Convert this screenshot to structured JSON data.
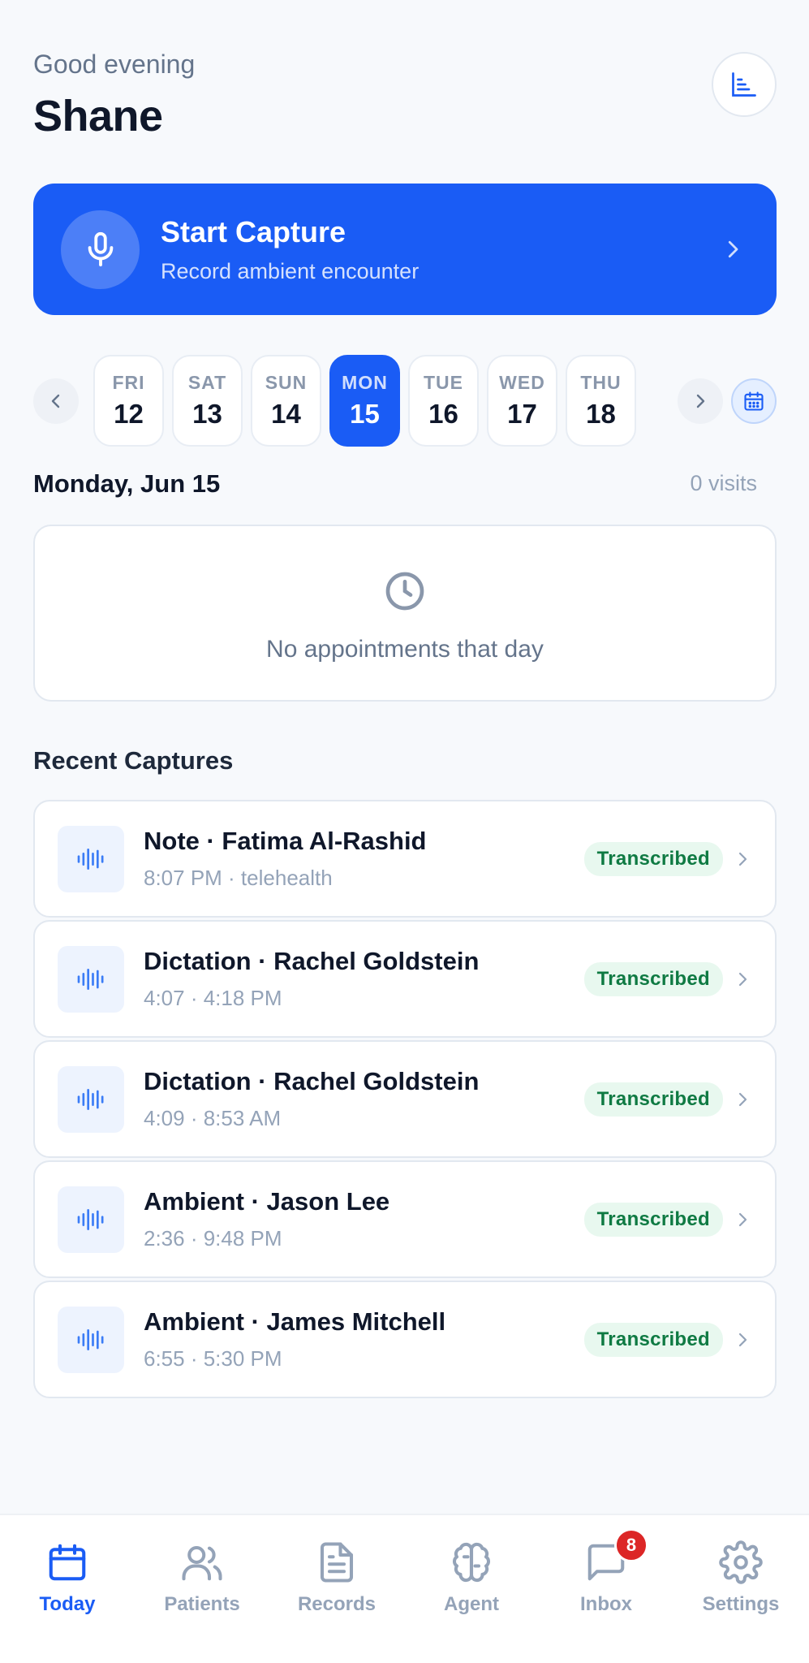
{
  "header": {
    "greeting": "Good evening",
    "user_name": "Shane"
  },
  "capture_card": {
    "title": "Start Capture",
    "subtitle": "Record ambient encounter"
  },
  "date_strip": {
    "days": [
      {
        "dow": "FRI",
        "num": "12",
        "selected": false
      },
      {
        "dow": "SAT",
        "num": "13",
        "selected": false
      },
      {
        "dow": "SUN",
        "num": "14",
        "selected": false
      },
      {
        "dow": "MON",
        "num": "15",
        "selected": true
      },
      {
        "dow": "TUE",
        "num": "16",
        "selected": false
      },
      {
        "dow": "WED",
        "num": "17",
        "selected": false
      },
      {
        "dow": "THU",
        "num": "18",
        "selected": false
      }
    ]
  },
  "schedule": {
    "date_label": "Monday, Jun 15",
    "visit_count": "0 visits",
    "empty_message": "No appointments that day"
  },
  "recent": {
    "title": "Recent Captures",
    "items": [
      {
        "title": "Note · Fatima Al-Rashid",
        "meta": "8:07 PM · telehealth",
        "status": "Transcribed"
      },
      {
        "title": "Dictation · Rachel Goldstein",
        "meta": "4:07 · 4:18 PM",
        "status": "Transcribed"
      },
      {
        "title": "Dictation · Rachel Goldstein",
        "meta": "4:09 · 8:53 AM",
        "status": "Transcribed"
      },
      {
        "title": "Ambient · Jason Lee",
        "meta": "2:36 · 9:48 PM",
        "status": "Transcribed"
      },
      {
        "title": "Ambient · James Mitchell",
        "meta": "6:55 · 5:30 PM",
        "status": "Transcribed"
      }
    ]
  },
  "nav": {
    "items": [
      {
        "label": "Today",
        "icon": "calendar-icon",
        "active": true
      },
      {
        "label": "Patients",
        "icon": "users-icon",
        "active": false
      },
      {
        "label": "Records",
        "icon": "document-icon",
        "active": false
      },
      {
        "label": "Agent",
        "icon": "brain-icon",
        "active": false
      },
      {
        "label": "Inbox",
        "icon": "message-icon",
        "active": false,
        "badge": "8"
      },
      {
        "label": "Settings",
        "icon": "gear-icon",
        "active": false
      }
    ]
  },
  "colors": {
    "accent": "#1a5cf5",
    "success_bg": "#e8f8ef",
    "success_text": "#0f7a43",
    "badge": "#dc2626"
  }
}
